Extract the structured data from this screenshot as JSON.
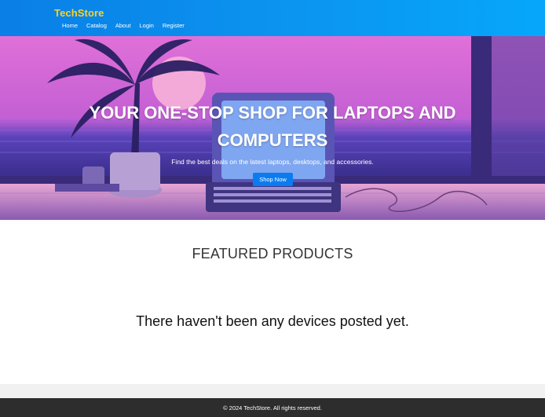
{
  "header": {
    "logo": "TechStore",
    "nav": [
      "Home",
      "Catalog",
      "About",
      "Login",
      "Register"
    ]
  },
  "hero": {
    "title_line1": "YOUR ONE-STOP SHOP FOR LAPTOPS AND",
    "title_line2": "COMPUTERS",
    "subtitle": "Find the best deals on the latest laptops, desktops, and accessories.",
    "button": "Shop Now"
  },
  "main": {
    "featured_title": "FEATURED PRODUCTS",
    "empty_message": "There haven't been any devices posted yet."
  },
  "footer": {
    "text": "© 2024 TechStore. All rights reserved."
  },
  "colors": {
    "header_bg": "#0b95f0",
    "logo": "#ffd21f",
    "button": "#0b7cf0",
    "footer_bg": "#2d2d2d"
  }
}
